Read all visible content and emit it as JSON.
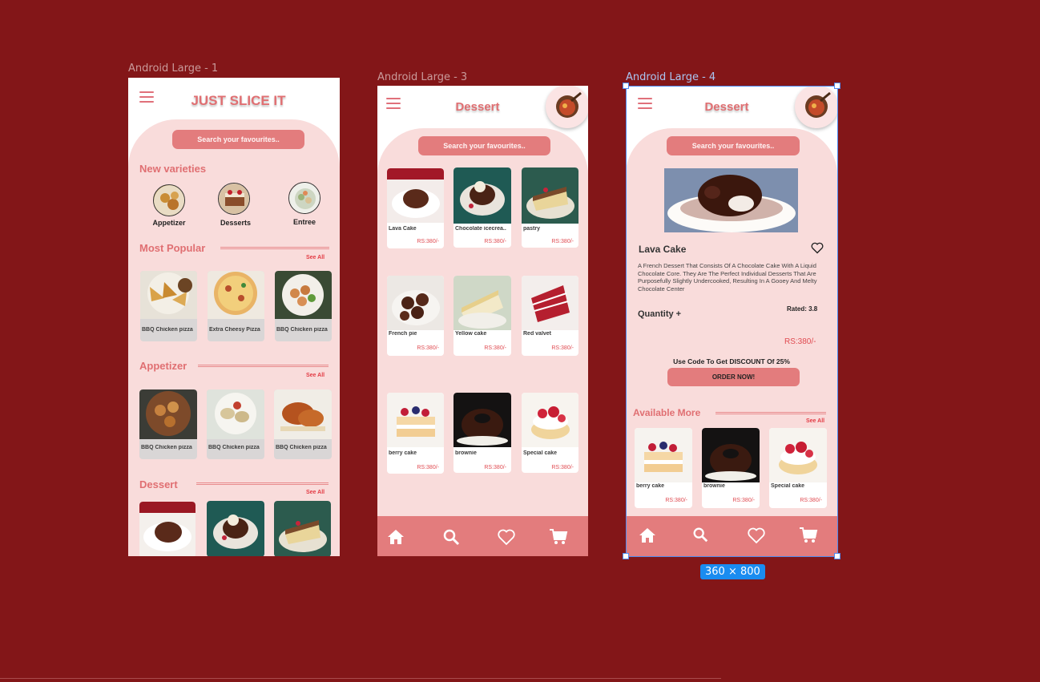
{
  "frames": {
    "f1_label": "Android Large - 1",
    "f3_label": "Android Large - 3",
    "f4_label": "Android Large - 4",
    "size_badge": "360 × 800"
  },
  "screen1": {
    "title": "JUST SLICE IT",
    "search_placeholder": "Search your favourites..",
    "new_varieties": "New  varieties",
    "varieties": [
      {
        "label": "Appetizer"
      },
      {
        "label": "Desserts"
      },
      {
        "label": "Entree"
      }
    ],
    "most_popular": "Most Popular",
    "see_all": "See All",
    "popular_items": [
      {
        "name": "BBQ Chicken pizza"
      },
      {
        "name": "Extra Cheesy Pizza"
      },
      {
        "name": "BBQ Chicken pizza"
      }
    ],
    "appetizer": "Appetizer",
    "appetizer_items": [
      {
        "name": "BBQ Chicken pizza"
      },
      {
        "name": "BBQ Chicken pizza"
      },
      {
        "name": "BBQ Chicken pizza"
      }
    ],
    "dessert": "Dessert"
  },
  "screen3": {
    "title": "Dessert",
    "search_placeholder": "Search your favourites..",
    "items": [
      {
        "name": "Lava Cake",
        "price": "RS:380/-"
      },
      {
        "name": "Chocolate icecrea..",
        "price": "RS:380/-"
      },
      {
        "name": "pastry",
        "price": "RS:380/-"
      },
      {
        "name": "French pie",
        "price": "RS:380/-"
      },
      {
        "name": "Yellow cake",
        "price": "RS:380/-"
      },
      {
        "name": "Red valvet",
        "price": "RS:380/-"
      },
      {
        "name": "berry cake",
        "price": "RS:380/-"
      },
      {
        "name": "brownie",
        "price": "RS:380/-"
      },
      {
        "name": "Special cake",
        "price": "RS:380/-"
      }
    ]
  },
  "screen4": {
    "title": "Dessert",
    "search_placeholder": "Search your favourites..",
    "product_name": "Lava Cake",
    "description": "A French Dessert That Consists Of A Chocolate Cake With A Liquid Chocolate Core. They Are The Perfect Individual Desserts That Are Purposefully Slightly Undercooked, Resulting In A Gooey And Melty Chocolate Center",
    "quantity": "Quantity +",
    "rated": "Rated: 3.8",
    "price": "RS:380/-",
    "discount": "Use Code To Get DISCOUNT Of 25%",
    "order_button": "ORDER NOW!",
    "available_more": "Available More",
    "see_all": "See All",
    "more_items": [
      {
        "name": "berry cake",
        "price": "RS:380/-"
      },
      {
        "name": "brownie",
        "price": "RS:380/-"
      },
      {
        "name": "Special cake",
        "price": "RS:380/-"
      }
    ]
  },
  "nav_icons": [
    "home-icon",
    "search-icon",
    "heart-icon",
    "cart-icon"
  ],
  "colors": {
    "background": "#831618",
    "accent": "#e37c7d",
    "pink_panel": "#f9dcdb",
    "selection": "#4f8bf0"
  }
}
